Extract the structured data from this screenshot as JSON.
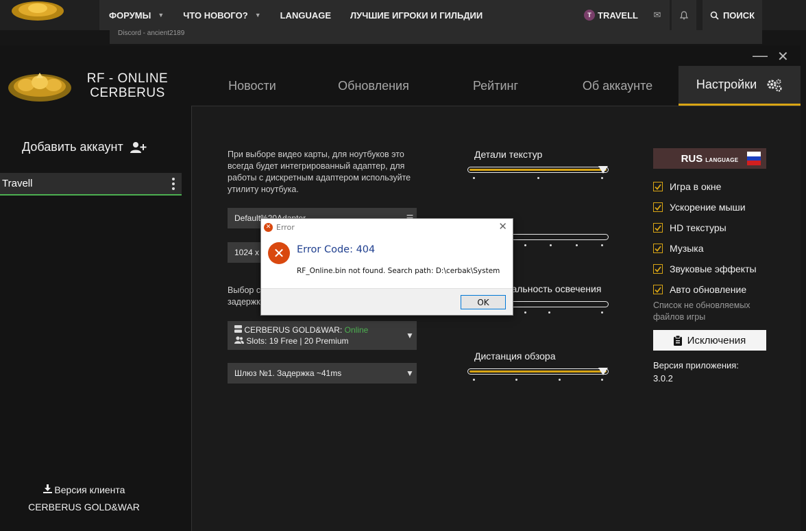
{
  "forum": {
    "nav": [
      {
        "label": "ФОРУМЫ",
        "dropdown": true
      },
      {
        "label": "ЧТО НОВОГО?",
        "dropdown": true
      },
      {
        "label": "LANGUAGE",
        "dropdown": false
      },
      {
        "label": "ЛУЧШИЕ ИГРОКИ И ГИЛЬДИИ",
        "dropdown": false
      }
    ],
    "user": {
      "initial": "T",
      "name": "TRAVELL"
    },
    "search_label": "ПОИСК",
    "subline": "Discord - ancient2189"
  },
  "launcher": {
    "brand_line1": "RF - ONLINE",
    "brand_line2": "CERBERUS",
    "tabs": [
      {
        "label": "Новости"
      },
      {
        "label": "Обновления"
      },
      {
        "label": "Рейтинг"
      },
      {
        "label": "Об аккаунте"
      },
      {
        "label": "Настройки",
        "active": true
      }
    ],
    "sidebar": {
      "add_account": "Добавить аккаунт",
      "account": "Travell",
      "client_version_label": "Версия клиента",
      "client_version_value": "CERBERUS GOLD&WAR"
    },
    "settings": {
      "video_desc": "При выборе видео карты, для ноутбуков это всегда будет интегрированный адаптер, для работы с дискретным адаптером используйте утилиту ноутбука.",
      "adapter_value": "Default%20Adapter",
      "resolution_value": "1024 x 768",
      "server_desc_line1": "Выбор сервера",
      "server_desc_line2": "задержка",
      "server_name": "CERBERUS GOLD&WAR:",
      "server_status": "Online",
      "server_slots": "Slots: 19 Free | 20 Premium",
      "gateway_value": "Шлюз №1. Задержка ~41ms",
      "sliders": [
        {
          "label": "Детали текстур",
          "value": 1.0
        },
        {
          "label": "",
          "value": 0.0
        },
        {
          "label": "Дальность освечения",
          "value": 0.0
        },
        {
          "label": "Дистанция обзора",
          "value": 1.0
        }
      ],
      "lang": {
        "code": "RUS",
        "word": "LANGUAGE"
      },
      "checkboxes": [
        {
          "label": "Игра в окне",
          "checked": true
        },
        {
          "label": "Ускорение мыши",
          "checked": true
        },
        {
          "label": "HD текстуры",
          "checked": true
        },
        {
          "label": "Музыка",
          "checked": true
        },
        {
          "label": "Звуковые эффекты",
          "checked": true
        },
        {
          "label": "Авто обновление",
          "checked": true
        }
      ],
      "note": "Список не обновляемых файлов игры",
      "exclusions_label": "Исключения",
      "app_version_label": "Версия приложения:",
      "app_version_value": "3.0.2"
    }
  },
  "dialog": {
    "title": "Error",
    "heading": "Error Code: 404",
    "message": "RF_Online.bin not found. Search path: D:\\cerbak\\System",
    "ok_label": "OK"
  },
  "colors": {
    "accent": "#d9a514",
    "online": "#4caf50",
    "error": "#d9480f"
  }
}
